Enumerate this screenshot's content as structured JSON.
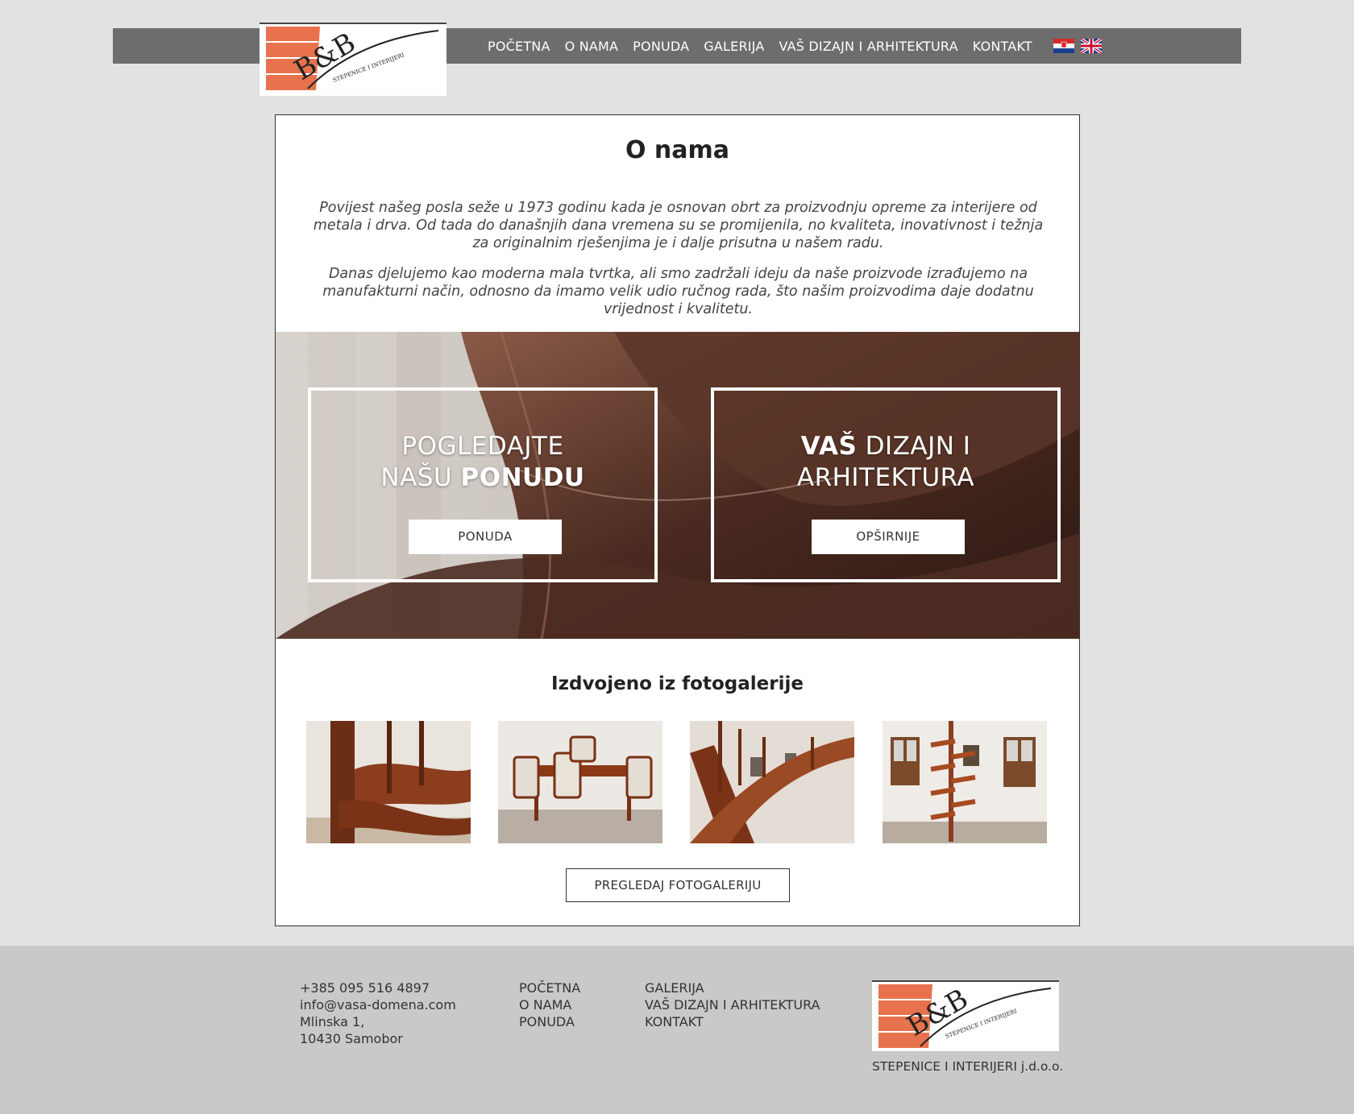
{
  "header": {
    "logo_text": "B&B",
    "logo_tagline": "STEPENICE I INTERIJERI",
    "nav": [
      "POČETNA",
      "O NAMA",
      "PONUDA",
      "GALERIJA",
      "VAŠ DIZAJN I ARHITEKTURA",
      "KONTAKT"
    ],
    "flags": [
      "croatian-flag-icon",
      "uk-flag-icon"
    ]
  },
  "main": {
    "title": "O nama",
    "paragraphs": [
      "Povijest našeg posla seže u 1973 godinu kada je osnovan obrt za proizvodnju opreme za interijere od metala i drva. Od tada do današnjih dana vremena su se promijenila, no kvaliteta, inovativnost i težnja za originalnim rješenjima je i dalje prisutna u našem radu.",
      "Danas djelujemo kao moderna mala tvrtka, ali smo zadržali ideju da naše proizvode izrađujemo na manufakturni način, odnosno da imamo velik udio ručnog rada, što našim proizvodima daje dodatnu vrijednost i kvalitetu."
    ],
    "cta_left": {
      "line1": "POGLEDAJTE",
      "line2_pre": "NAŠU ",
      "line2_bold": "PONUDU",
      "button": "PONUDA"
    },
    "cta_right": {
      "line1_bold": "VAŠ",
      "line1_post": " DIZAJN I",
      "line2": "ARHITEKTURA",
      "button": "OPŠIRNIJE"
    },
    "gallery_title": "Izdvojeno iz fotogalerije",
    "gallery_button": "PREGLEDAJ FOTOGALERIJU"
  },
  "footer": {
    "contact": [
      "+385 095 516 4897",
      "info@vasa-domena.com",
      "Mlinska 1,",
      "10430 Samobor"
    ],
    "links_col1": [
      "POČETNA",
      "O NAMA",
      "PONUDA"
    ],
    "links_col2": [
      "GALERIJA",
      "VAŠ DIZAJN I ARHITEKTURA",
      "KONTAKT"
    ],
    "company": "STEPENICE I INTERIJERI j.d.o.o."
  },
  "colors": {
    "accent": "#e8724d",
    "navbar": "#6d6d6d",
    "footer": "#c9c9c9"
  }
}
